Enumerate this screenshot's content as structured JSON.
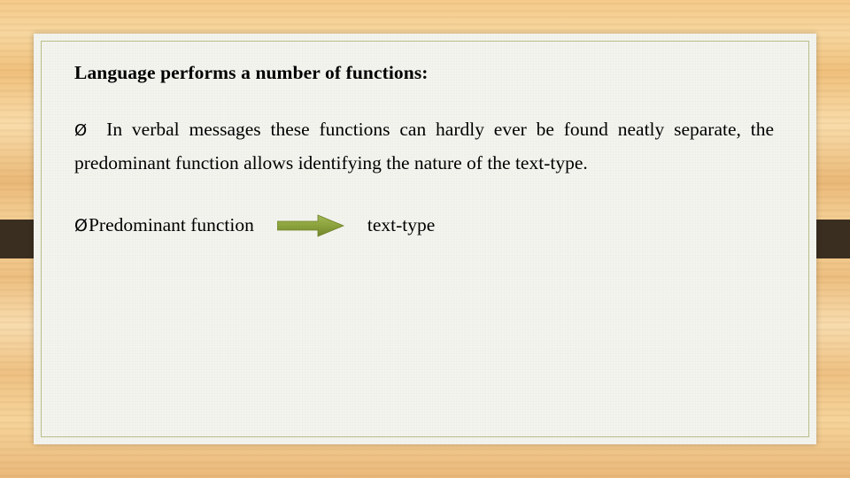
{
  "slide": {
    "heading": "Language performs a number of functions:",
    "bullet1": {
      "marker": "Ø",
      "text": "In verbal messages these functions can hardly ever be found neatly separate, the predominant function allows identifying the nature of the text-type."
    },
    "bullet2": {
      "marker": "Ø",
      "label_left": "Predominant function",
      "label_right": "text-type",
      "arrow_icon": "right-arrow-icon",
      "arrow_color": "#8aa03c"
    },
    "colors": {
      "card_background": "#f4f4ef",
      "card_border": "#b9c08a",
      "band": "#3a2e20",
      "text": "#000000"
    }
  }
}
